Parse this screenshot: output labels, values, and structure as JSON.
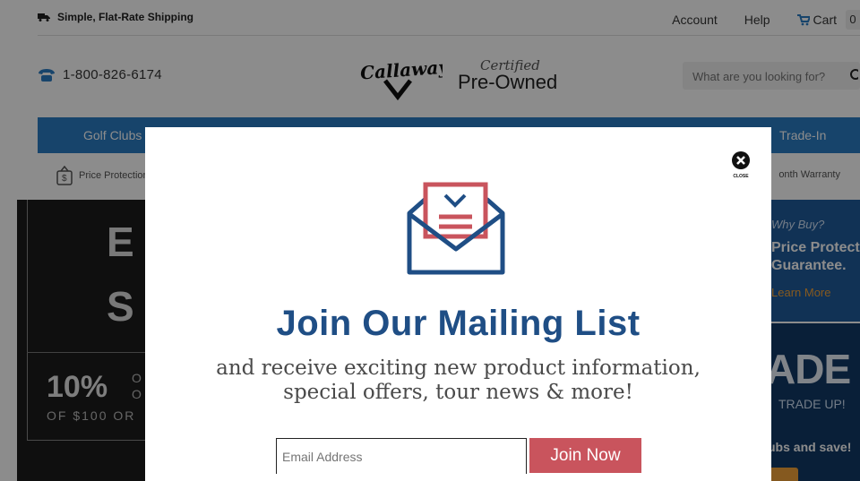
{
  "topbar": {
    "shipping": "Simple, Flat-Rate Shipping",
    "account": "Account",
    "help": "Help",
    "cart": "Cart",
    "cart_count": "0"
  },
  "header": {
    "phone": "1-800-826-6174",
    "logo_brand": "Callaway",
    "logo_certified": "Certified",
    "logo_preowned": "Pre-Owned",
    "search_placeholder": "What are you looking for?"
  },
  "nav": {
    "items": [
      "Golf Clubs",
      "Trade-In"
    ]
  },
  "trust": {
    "left": "Price Protection",
    "right": "onth Warranty"
  },
  "hero": {
    "big_letters": [
      "E",
      "S"
    ],
    "pct": "10%",
    "pct_side": [
      "O",
      "O"
    ],
    "pct_sub": "OF $100 OR"
  },
  "promo": {
    "why": "Why Buy?",
    "title": [
      "Price Protect",
      "Guarantee."
    ],
    "learn_more": "Learn More",
    "trade_big": "ADE",
    "trade_up": "TRADE UP!",
    "clubs_save": "ubs and save!"
  },
  "modal": {
    "close_label": "CLOSE",
    "title": "Join Our Mailing List",
    "subtitle_1": "and receive exciting new product information,",
    "subtitle_2": "special offers, tour news & more!",
    "email_placeholder": "Email Address",
    "join_button": "Join Now"
  },
  "colors": {
    "nav_blue": "#2b7dc4",
    "title_blue": "#1f4e85",
    "accent_red": "#c9545d",
    "promo_blue": "#1f5b9b"
  }
}
